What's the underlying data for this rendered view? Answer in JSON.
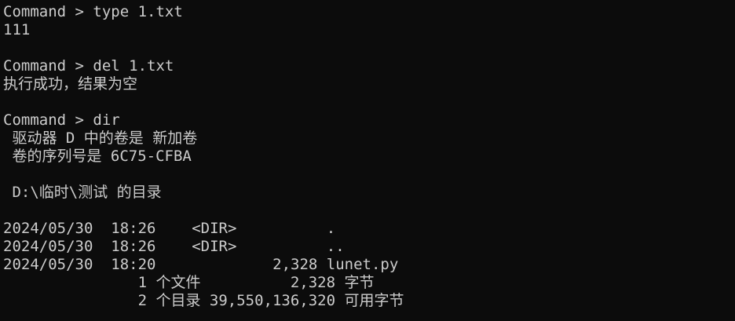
{
  "terminal": {
    "lines": [
      "Command > type 1.txt",
      "111",
      "",
      "Command > del 1.txt",
      "执行成功，结果为空",
      "",
      "Command > dir",
      " 驱动器 D 中的卷是 新加卷",
      " 卷的序列号是 6C75-CFBA",
      "",
      " D:\\临时\\测试 的目录",
      "",
      "2024/05/30  18:26    <DIR>          .",
      "2024/05/30  18:26    <DIR>          ..",
      "2024/05/30  18:20             2,328 lunet.py",
      "               1 个文件          2,328 字节",
      "               2 个目录 39,550,136,320 可用字节"
    ]
  }
}
